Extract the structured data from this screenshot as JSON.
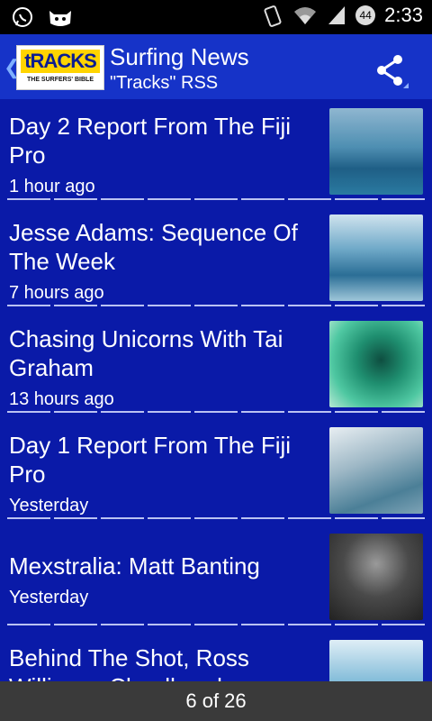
{
  "statusbar": {
    "time": "2:33",
    "battery": "44"
  },
  "appbar": {
    "title": "Surfing News",
    "subtitle": "\"Tracks\" RSS",
    "logo_brand": "tRACKS",
    "logo_sub": "THE SURFERS' BIBLE"
  },
  "items": [
    {
      "headline": "Day 2 Report From The Fiji Pro",
      "time": "1 hour ago"
    },
    {
      "headline": "Jesse Adams: Sequence Of The Week",
      "time": "7 hours ago"
    },
    {
      "headline": "Chasing Unicorns With Tai Graham",
      "time": "13 hours ago"
    },
    {
      "headline": "Day 1 Report From The Fiji Pro",
      "time": "Yesterday"
    },
    {
      "headline": "Mexstralia: Matt Banting",
      "time": "Yesterday"
    },
    {
      "headline": "Behind The Shot, Ross Williams, Cloudbreak",
      "time": ""
    }
  ],
  "footer": {
    "pager": "6 of 26"
  },
  "colors": {
    "background": "#0a1aa8",
    "appbar": "#1633c8",
    "footer": "#3a3a3a"
  }
}
